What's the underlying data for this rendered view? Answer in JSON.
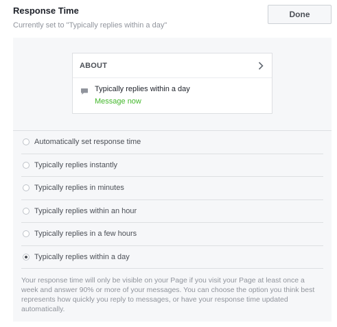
{
  "header": {
    "title": "Response Time",
    "subtitle": "Currently set to \"Typically replies within a day\"",
    "done_label": "Done"
  },
  "about_card": {
    "title": "ABOUT",
    "response_text": "Typically replies within a day",
    "message_link": "Message now",
    "icons": [
      "chevron-right-icon",
      "message-bubble-icon"
    ],
    "link_color": "#42b72a"
  },
  "options": [
    {
      "label": "Automatically set response time",
      "selected": false
    },
    {
      "label": "Typically replies instantly",
      "selected": false
    },
    {
      "label": "Typically replies in minutes",
      "selected": false
    },
    {
      "label": "Typically replies within an hour",
      "selected": false
    },
    {
      "label": "Typically replies in a few hours",
      "selected": false
    },
    {
      "label": "Typically replies within a day",
      "selected": true
    }
  ],
  "note": "Your response time will only be visible on your Page if you visit your Page at least once a week and answer 90% or more of your messages. You can choose the option you think best represents how quickly you reply to messages, or have your response time updated automatically."
}
